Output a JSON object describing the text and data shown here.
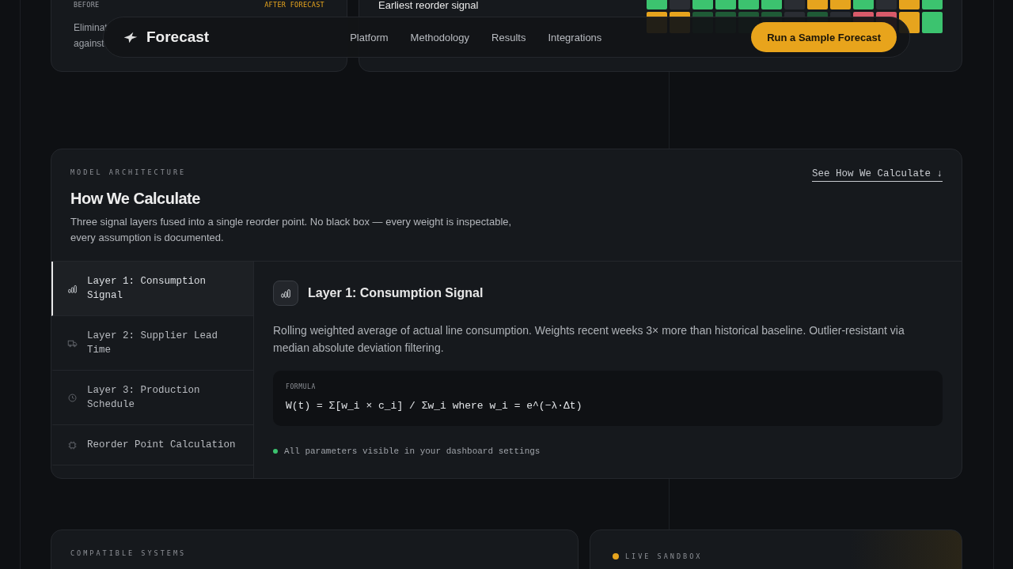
{
  "top_cards": {
    "before_label": "BEFORE",
    "after_label": "AFTER FORECAST",
    "lines": [
      "Eliminat",
      "against"
    ],
    "signal_title": "Earliest reorder signal",
    "heatmap": [
      {
        "cells": [
          {
            "color": "#3cc36f"
          },
          {
            "color": "#2a2d33"
          },
          {
            "color": "#3cc36f"
          },
          {
            "color": "#3cc36f"
          },
          {
            "color": "#3cc36f"
          },
          {
            "color": "#3cc36f"
          },
          {
            "color": "#2a2d33"
          },
          {
            "color": "#e6a41e"
          },
          {
            "color": "#e6a41e"
          },
          {
            "color": "#3cc36f"
          },
          {
            "color": "#2a2d33"
          },
          {
            "color": "#e6a41e"
          },
          {
            "color": "#3cc36f"
          }
        ]
      },
      {
        "cells": [
          {
            "color": "#e6a41e"
          },
          {
            "color": "#e6a41e"
          },
          {
            "color": "#1f5a36"
          },
          {
            "color": "#1f5a36"
          },
          {
            "color": "#1f5a36"
          },
          {
            "color": "#1f5a36"
          },
          {
            "color": "#2a2d33"
          },
          {
            "color": "#1f5a36"
          },
          {
            "color": "#2a2d33"
          },
          {
            "color": "#d95a6a"
          },
          {
            "color": "#d95a6a"
          },
          {
            "color": "#e6a41e"
          },
          {
            "color": "#3cc36f"
          }
        ]
      }
    ]
  },
  "nav": {
    "brand": "Forecast",
    "links": [
      "Platform",
      "Methodology",
      "Results",
      "Integrations"
    ],
    "cta": "Run a Sample Forecast"
  },
  "section": {
    "eyebrow": "MODEL ARCHITECTURE",
    "title": "How We Calculate",
    "intro": "Three signal layers fused into a single reorder point. No black box — every weight is inspectable, every assumption is documented.",
    "link": "See How We Calculate ↓",
    "tabs": [
      {
        "label": "Layer 1: Consumption Signal",
        "kind": "bars",
        "selected": true
      },
      {
        "label": "Layer 2: Supplier Lead Time",
        "kind": "truck",
        "selected": false
      },
      {
        "label": "Layer 3: Production Schedule",
        "kind": "clock",
        "selected": false
      },
      {
        "label": "Reorder Point Calculation",
        "kind": "chip",
        "selected": false
      }
    ],
    "detail": {
      "title": "Layer 1: Consumption Signal",
      "kind": "bars",
      "text": "Rolling weighted average of actual line consumption. Weights recent weeks 3× more than historical baseline. Outlier-resistant via median absolute deviation filtering.",
      "formula_label": "FORMULA",
      "formula": "W(t) = Σ[w_i × c_i] / Σw_i where w_i = e^(−λ·Δt)",
      "note": "All parameters visible in your dashboard settings"
    }
  },
  "bottom": {
    "left_eyebrow": "COMPATIBLE SYSTEMS",
    "right_eyebrow": "LIVE SANDBOX"
  }
}
